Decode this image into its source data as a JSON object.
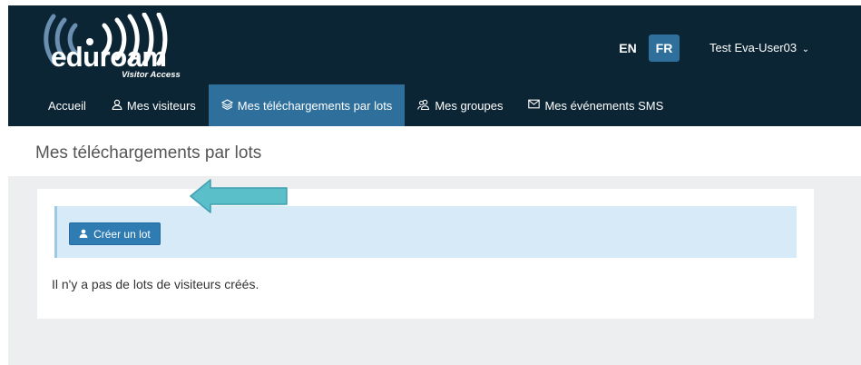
{
  "header": {
    "logo_text_edu": "edu",
    "logo_text_roam": "roam",
    "logo_subtitle": "Visitor Access",
    "languages": [
      {
        "code": "EN",
        "active": false
      },
      {
        "code": "FR",
        "active": true
      }
    ],
    "user_name": "Test Eva-User03",
    "user_caret": "⌄"
  },
  "nav": {
    "items": [
      {
        "label": "Accueil",
        "icon": "",
        "active": false
      },
      {
        "label": "Mes visiteurs",
        "icon": "user-icon",
        "active": false
      },
      {
        "label": "Mes téléchargements par lots",
        "icon": "layers-icon",
        "active": true
      },
      {
        "label": "Mes groupes",
        "icon": "users-icon",
        "active": false
      },
      {
        "label": "Mes événements SMS",
        "icon": "envelope-icon",
        "active": false
      }
    ]
  },
  "page": {
    "title": "Mes téléchargements par lots",
    "create_button_label": "Créer un lot",
    "create_button_icon": "person-icon",
    "empty_message": "Il n'y a pas de lots de visiteurs créés."
  },
  "colors": {
    "header_bg": "#0c2534",
    "accent": "#2f6f9c",
    "button": "#2f7cb3",
    "info_bg": "#d6eaf7",
    "content_bg": "#eceeef",
    "annotation_arrow": "#5bbfca"
  }
}
